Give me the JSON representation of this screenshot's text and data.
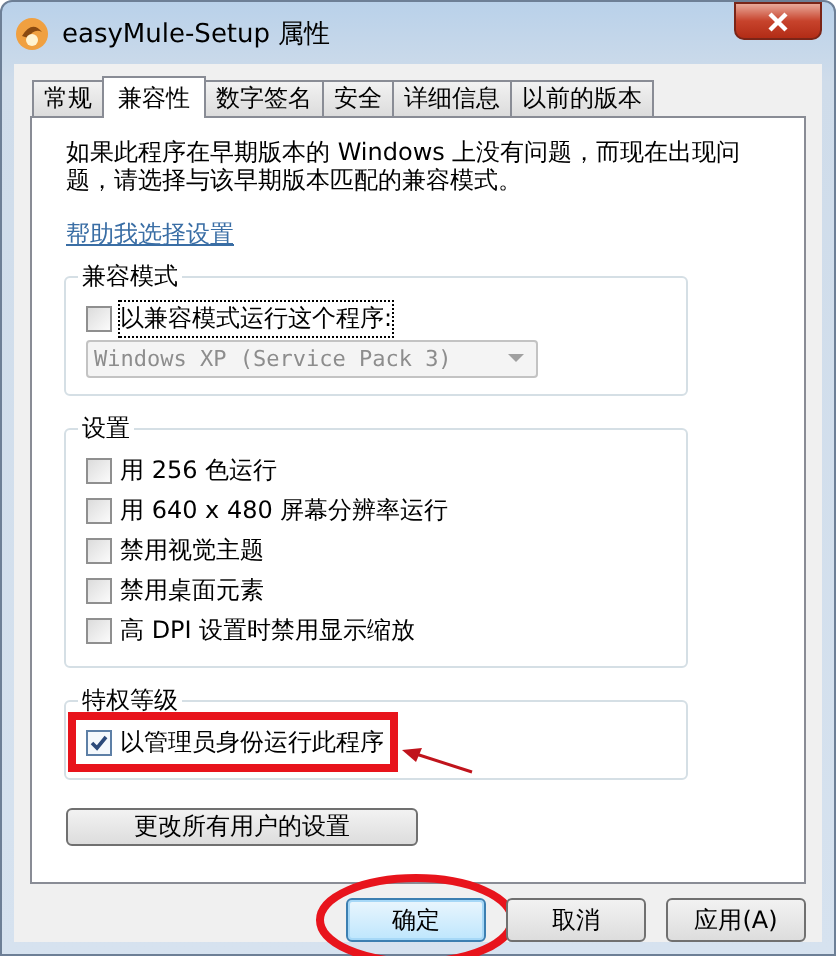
{
  "window": {
    "title": "easyMule-Setup 属性"
  },
  "tabs": [
    {
      "label": "常规",
      "selected": false
    },
    {
      "label": "兼容性",
      "selected": true
    },
    {
      "label": "数字签名",
      "selected": false
    },
    {
      "label": "安全",
      "selected": false
    },
    {
      "label": "详细信息",
      "selected": false
    },
    {
      "label": "以前的版本",
      "selected": false
    }
  ],
  "description": "如果此程序在早期版本的 Windows 上没有问题，而现在出现问题，请选择与该早期版本匹配的兼容模式。",
  "help_link": "帮助我选择设置",
  "groups": [
    {
      "title": "兼容模式",
      "items": [
        {
          "kind": "checkbox",
          "label": "以兼容模式运行这个程序:",
          "checked": false,
          "focused": true
        },
        {
          "kind": "dropdown",
          "value": "Windows XP (Service Pack 3)",
          "disabled": true
        }
      ]
    },
    {
      "title": "设置",
      "items": [
        {
          "kind": "checkbox",
          "label": "用 256 色运行",
          "checked": false
        },
        {
          "kind": "checkbox",
          "label": "用 640 x 480 屏幕分辨率运行",
          "checked": false
        },
        {
          "kind": "checkbox",
          "label": "禁用视觉主题",
          "checked": false
        },
        {
          "kind": "checkbox",
          "label": "禁用桌面元素",
          "checked": false
        },
        {
          "kind": "checkbox",
          "label": "高 DPI 设置时禁用显示缩放",
          "checked": false
        }
      ]
    },
    {
      "title": "特权等级",
      "items": [
        {
          "kind": "checkbox",
          "label": "以管理员身份运行此程序",
          "checked": true,
          "highlighted": true
        }
      ]
    }
  ],
  "all_users_button": "更改所有用户的设置",
  "buttons": [
    {
      "label": "确定",
      "default": true,
      "circled": true
    },
    {
      "label": "取消",
      "default": false
    },
    {
      "label": "应用(A)",
      "default": false
    }
  ]
}
